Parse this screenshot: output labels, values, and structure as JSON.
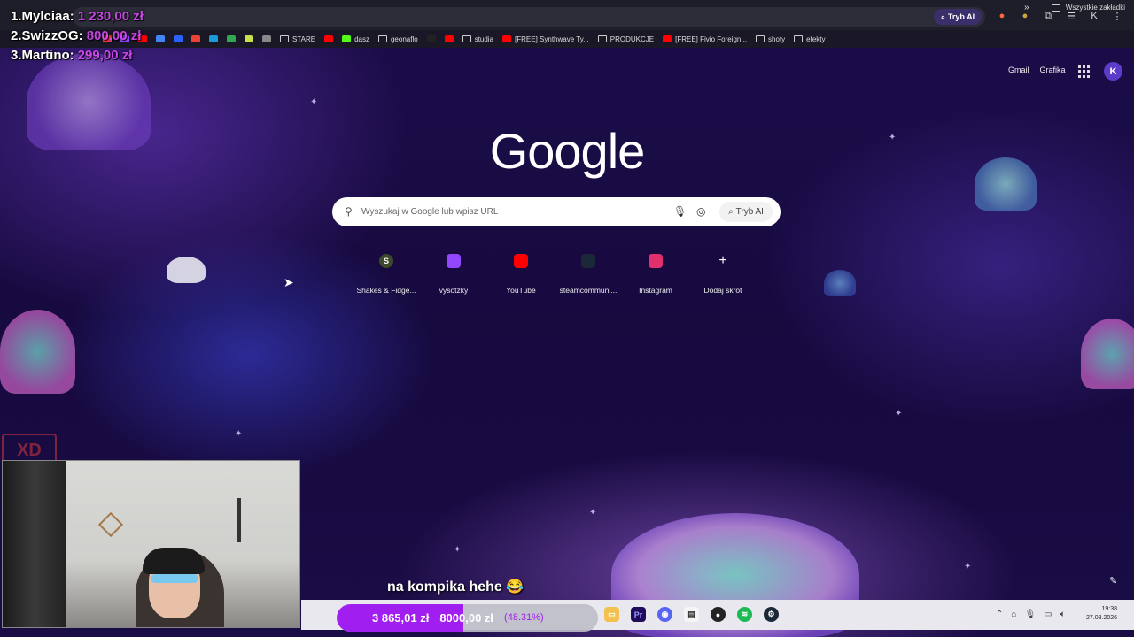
{
  "leaderboard": [
    {
      "label": "1.Mylciaa:",
      "amount": "1 230,00 zł"
    },
    {
      "label": "2.SwizzOG:",
      "amount": "800,00 zł"
    },
    {
      "label": "3.Martino:",
      "amount": "299,00 zł"
    }
  ],
  "chrome": {
    "ai_mode": "Tryb AI",
    "profile_initial": "K"
  },
  "bookmarks": {
    "items": [
      {
        "label": "",
        "color": "#ff3b3b",
        "type": "site"
      },
      {
        "label": "",
        "color": "#9146ff",
        "type": "site"
      },
      {
        "label": "",
        "color": "#ff0000",
        "type": "site"
      },
      {
        "label": "",
        "color": "#4285f4",
        "type": "site"
      },
      {
        "label": "",
        "color": "#2b62ff",
        "type": "site"
      },
      {
        "label": "",
        "color": "#ea4335",
        "type": "site"
      },
      {
        "label": "",
        "color": "#1a9ad6",
        "type": "site"
      },
      {
        "label": "",
        "color": "#2fa84f",
        "type": "site"
      },
      {
        "label": "",
        "color": "#c9e04a",
        "type": "site"
      },
      {
        "label": "",
        "color": "#888",
        "type": "site"
      },
      {
        "label": "STARE",
        "color": "#ccc",
        "type": "folder"
      },
      {
        "label": "",
        "color": "#ff0000",
        "type": "site"
      },
      {
        "label": "dasz",
        "color": "#53fc18",
        "type": "site"
      },
      {
        "label": "geonaflo",
        "color": "#ccc",
        "type": "folder"
      },
      {
        "label": "",
        "color": "#222",
        "type": "site"
      },
      {
        "label": "",
        "color": "#ff0000",
        "type": "site"
      },
      {
        "label": "studia",
        "color": "#ccc",
        "type": "folder"
      },
      {
        "label": "[FREE] Synthwave Ty...",
        "color": "#ff0000",
        "type": "site"
      },
      {
        "label": "PRODUKCJE",
        "color": "#ccc",
        "type": "folder"
      },
      {
        "label": "[FREE] Fivio Foreign...",
        "color": "#ff0000",
        "type": "site"
      },
      {
        "label": "shoty",
        "color": "#ccc",
        "type": "folder"
      },
      {
        "label": "efekty",
        "color": "#ccc",
        "type": "folder"
      }
    ],
    "all_bookmarks": "Wszystkie zakładki"
  },
  "google": {
    "gmail": "Gmail",
    "images": "Grafika",
    "avatar": "K",
    "logo": "Google",
    "search_placeholder": "Wyszukaj w Google lub wpisz URL",
    "ai_mode": "Tryb AI",
    "shortcuts": [
      {
        "label": "Shakes & Fidge...",
        "letter": "S",
        "color": "#3d4a2a"
      },
      {
        "label": "vysotzky",
        "letter": "",
        "color": "#9146ff"
      },
      {
        "label": "YouTube",
        "letter": "",
        "color": "#ff0000"
      },
      {
        "label": "steamcommuni...",
        "letter": "",
        "color": "#1b2838"
      },
      {
        "label": "Instagram",
        "letter": "",
        "color": "#e1306c"
      },
      {
        "label": "Dodaj skrót",
        "letter": "+",
        "color": "transparent"
      }
    ]
  },
  "overlay": {
    "xd": "XD",
    "subtitle": "na kompika hehe 😂"
  },
  "donation_goal": {
    "current": "3 865,01 zł",
    "goal": "8000,00 zł",
    "percent_text": "(48.31%)",
    "progress_percent": 48.31
  },
  "clock": {
    "time": "19:38",
    "date": "27.08.2026"
  }
}
